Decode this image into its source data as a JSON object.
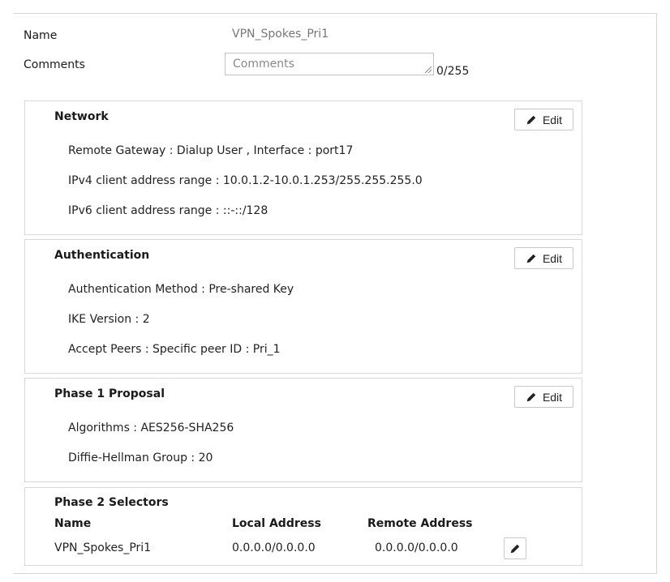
{
  "form": {
    "name_label": "Name",
    "name_value": "VPN_Spokes_Pri1",
    "comments_label": "Comments",
    "comments_placeholder": "Comments",
    "comments_counter": "0/255"
  },
  "panels": {
    "network": {
      "title": "Network",
      "edit_label": "Edit",
      "lines": [
        "Remote Gateway : Dialup User , Interface : port17",
        "IPv4 client address range : 10.0.1.2-10.0.1.253/255.255.255.0",
        "IPv6 client address range : ::-::/128"
      ]
    },
    "authentication": {
      "title": "Authentication",
      "edit_label": "Edit",
      "lines": [
        "Authentication Method : Pre-shared Key",
        "IKE Version : 2",
        "Accept Peers : Specific peer ID : Pri_1"
      ]
    },
    "phase1": {
      "title": "Phase 1 Proposal",
      "edit_label": "Edit",
      "lines": [
        "Algorithms : AES256-SHA256",
        "Diffie-Hellman Group : 20"
      ]
    },
    "phase2": {
      "title": "Phase 2 Selectors",
      "columns": [
        "Name",
        "Local Address",
        "Remote Address"
      ],
      "rows": [
        [
          "VPN_Spokes_Pri1",
          "0.0.0.0/0.0.0.0",
          "0.0.0.0/0.0.0.0"
        ]
      ]
    }
  },
  "icons": {
    "edit": "pencil-icon",
    "resize": "resize-grip-icon"
  },
  "colors": {
    "border": "#d9d9d9",
    "muted_text": "#777777"
  }
}
